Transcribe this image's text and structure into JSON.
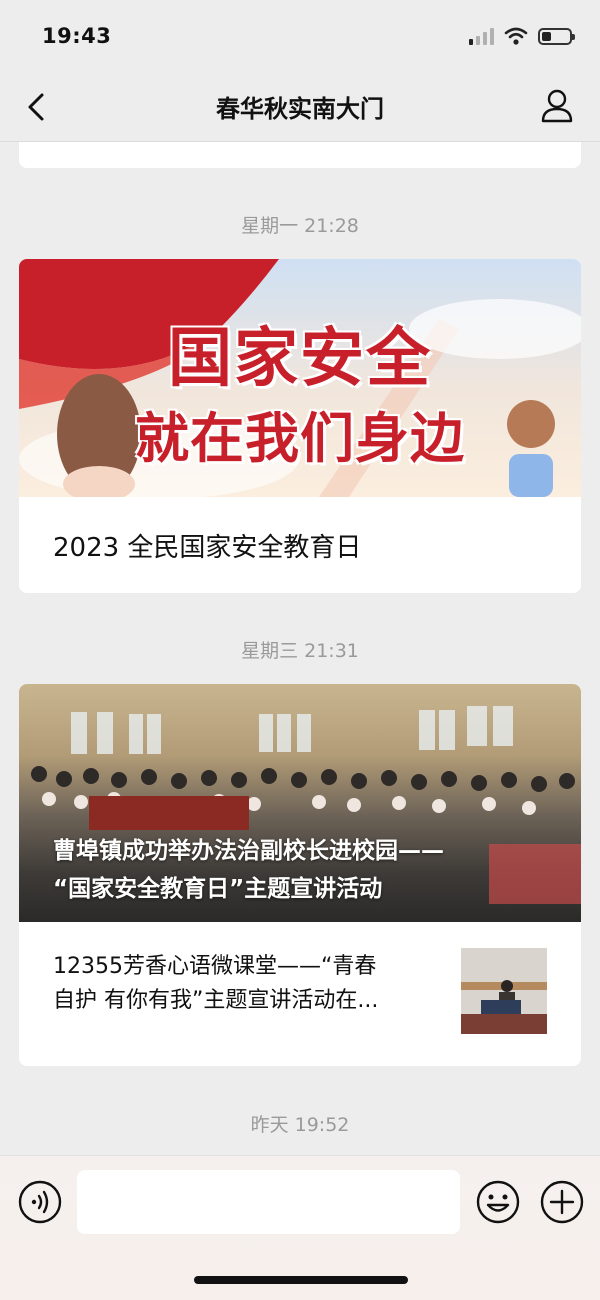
{
  "status": {
    "time": "19:43",
    "battery_level": 0.35
  },
  "nav": {
    "title": "春华秋实南大门",
    "back_icon": "chevron-left-icon",
    "profile_icon": "person-icon"
  },
  "messages": [
    {
      "timestamp": "星期一 21:28",
      "banner_text_line1": "国家安全",
      "banner_text_line2": "就在我们身边",
      "caption": "2023 全民国家安全教育日"
    },
    {
      "timestamp": "星期三 21:31",
      "main_title_line1": "曹埠镇成功举办法治副校长进校园——",
      "main_title_line2": "“国家安全教育日”主题宣讲活动",
      "sub_title_line1": "12355芳香心语微课堂——“青春",
      "sub_title_line2": "自护 有你有我”主题宣讲活动在..."
    },
    {
      "timestamp": "昨天 19:52"
    }
  ],
  "input_bar": {
    "voice_icon": "voice-icon",
    "emoji_icon": "emoji-icon",
    "plus_icon": "plus-icon"
  },
  "colors": {
    "banner_red": "#c8202a",
    "background": "#ededed"
  }
}
